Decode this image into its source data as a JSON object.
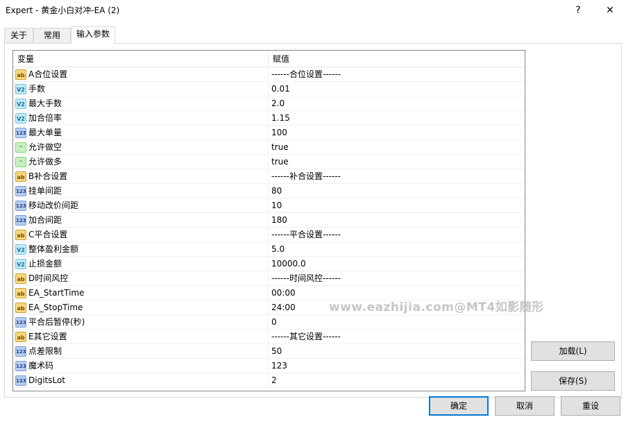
{
  "window": {
    "title": "Expert - 黄金小白对冲-EA (2)",
    "help_glyph": "?",
    "close_glyph": "✕"
  },
  "tabs": [
    {
      "label": "关于"
    },
    {
      "label": "常用"
    },
    {
      "label": "输入参数"
    }
  ],
  "grid": {
    "col_variable": "变量",
    "col_value": "赋值",
    "rows": [
      {
        "type": "string",
        "icon": "ab",
        "name": "A合位设置",
        "value": "------合位设置------"
      },
      {
        "type": "double",
        "icon": "v2",
        "name": "手数",
        "value": "0.01"
      },
      {
        "type": "double",
        "icon": "v2",
        "name": "最大手数",
        "value": "2.0"
      },
      {
        "type": "double",
        "icon": "v2",
        "name": "加合倍率",
        "value": "1.15"
      },
      {
        "type": "int",
        "icon": "123",
        "name": "最大单量",
        "value": "100"
      },
      {
        "type": "bool",
        "icon": "bool",
        "name": "允许做空",
        "value": "true"
      },
      {
        "type": "bool",
        "icon": "bool",
        "name": "允许做多",
        "value": "true"
      },
      {
        "type": "string",
        "icon": "ab",
        "name": "B补合设置",
        "value": "------补合设置------"
      },
      {
        "type": "int",
        "icon": "123",
        "name": "挂单间距",
        "value": "80"
      },
      {
        "type": "int",
        "icon": "123",
        "name": "移动改价间距",
        "value": "10"
      },
      {
        "type": "int",
        "icon": "123",
        "name": "加合间距",
        "value": "180"
      },
      {
        "type": "string",
        "icon": "ab",
        "name": "C平合设置",
        "value": "------平合设置------"
      },
      {
        "type": "double",
        "icon": "v2",
        "name": "整体盈利金额",
        "value": "5.0"
      },
      {
        "type": "double",
        "icon": "v2",
        "name": "止损金额",
        "value": "10000.0"
      },
      {
        "type": "string",
        "icon": "ab",
        "name": "D时间风控",
        "value": "------时间风控------"
      },
      {
        "type": "string",
        "icon": "ab",
        "name": "EA_StartTime",
        "value": "00:00"
      },
      {
        "type": "string",
        "icon": "ab",
        "name": "EA_StopTime",
        "value": "24:00"
      },
      {
        "type": "int",
        "icon": "123",
        "name": "平合后暂停(秒)",
        "value": "0"
      },
      {
        "type": "string",
        "icon": "ab",
        "name": "E其它设置",
        "value": "------其它设置------"
      },
      {
        "type": "int",
        "icon": "123",
        "name": "点差限制",
        "value": "50"
      },
      {
        "type": "int",
        "icon": "123",
        "name": "魔术码",
        "value": "123"
      },
      {
        "type": "int",
        "icon": "123",
        "name": "DigitsLot",
        "value": "2"
      }
    ]
  },
  "watermark": "www.eazhijia.com@MT4如影随形",
  "buttons": {
    "load": "加载(L)",
    "save": "保存(S)",
    "ok": "确定",
    "cancel": "取消",
    "reset": "重设"
  },
  "colors": {
    "focus_border": "#0078d7",
    "button_bg": "#e1e1e1"
  }
}
